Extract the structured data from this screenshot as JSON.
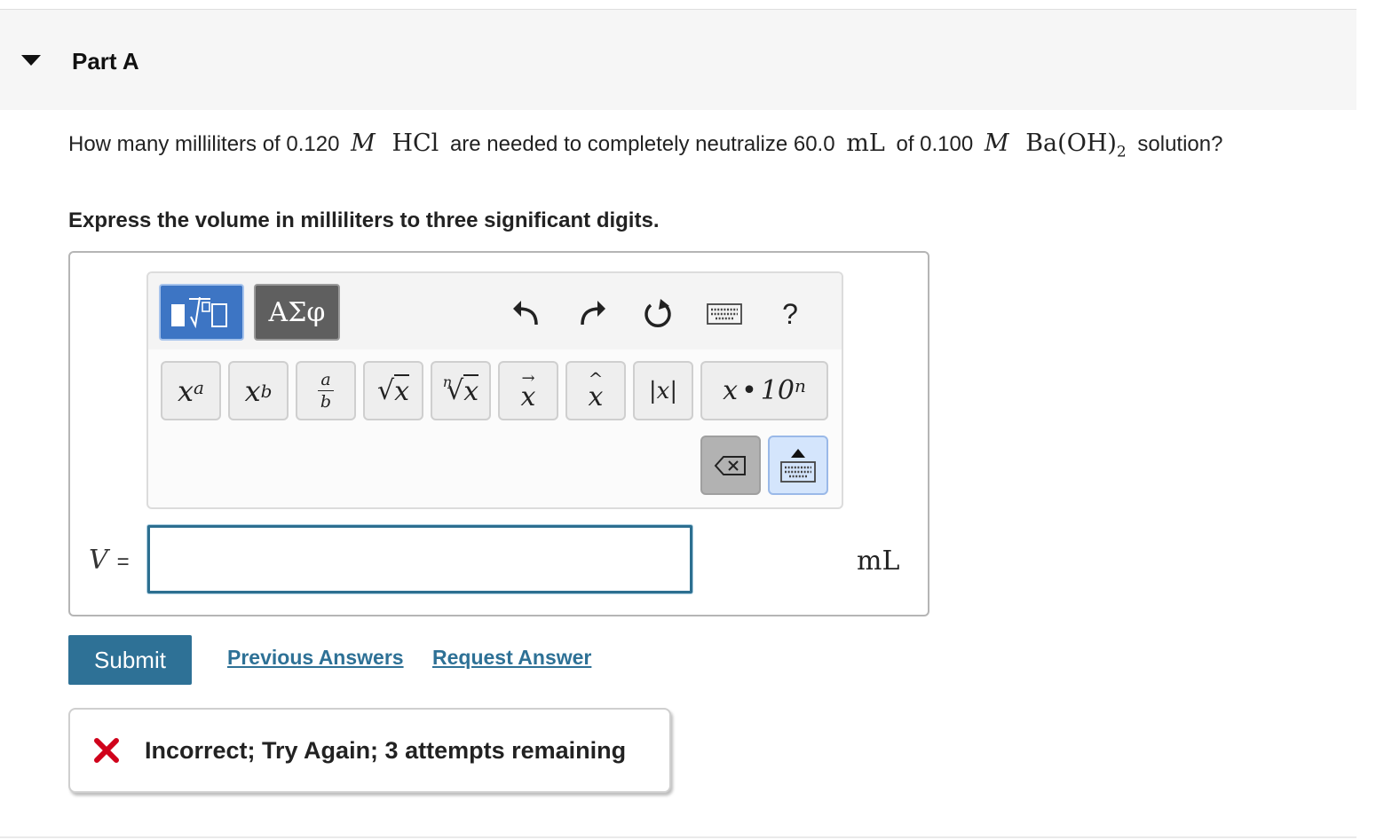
{
  "part": {
    "title": "Part A"
  },
  "question": {
    "t1": "How many milliliters of 0.120",
    "m_sym": "M",
    "hcl": "HCl",
    "t2": "are needed to completely neutralize 60.0",
    "ml": "mL",
    "t3": "of 0.100",
    "m_sym2": "M",
    "baoh": "Ba(OH)",
    "baoh_sub": "2",
    "t4": "solution?"
  },
  "instruction": "Express the volume in milliliters to three significant digits.",
  "toolbar": {
    "greek_label": "ΑΣφ",
    "help_label": "?",
    "keys": {
      "sup": {
        "base": "x",
        "exp": "a"
      },
      "sub": {
        "base": "x",
        "idx": "b"
      },
      "frac": {
        "num": "a",
        "den": "b"
      },
      "sqrt": {
        "sym": "√",
        "arg": "x"
      },
      "nroot": {
        "idx": "n",
        "sym": "√",
        "arg": "x"
      },
      "vec": {
        "arrow": "→",
        "arg": "x"
      },
      "hat": {
        "mark": "^",
        "arg": "x"
      },
      "abs": {
        "label": "|x|"
      },
      "sci": {
        "x": "x",
        "dot": "•",
        "ten": "10",
        "exp": "n"
      }
    }
  },
  "answer": {
    "var": "V",
    "eq": "=",
    "value": "",
    "unit": "mL"
  },
  "actions": {
    "submit": "Submit",
    "previous_answers": "Previous Answers",
    "request_answer": "Request Answer"
  },
  "feedback": {
    "message": "Incorrect; Try Again; 3 attempts remaining"
  },
  "colors": {
    "accent": "#2e7196",
    "template_btn": "#3d75c4",
    "error": "#d0021b"
  }
}
